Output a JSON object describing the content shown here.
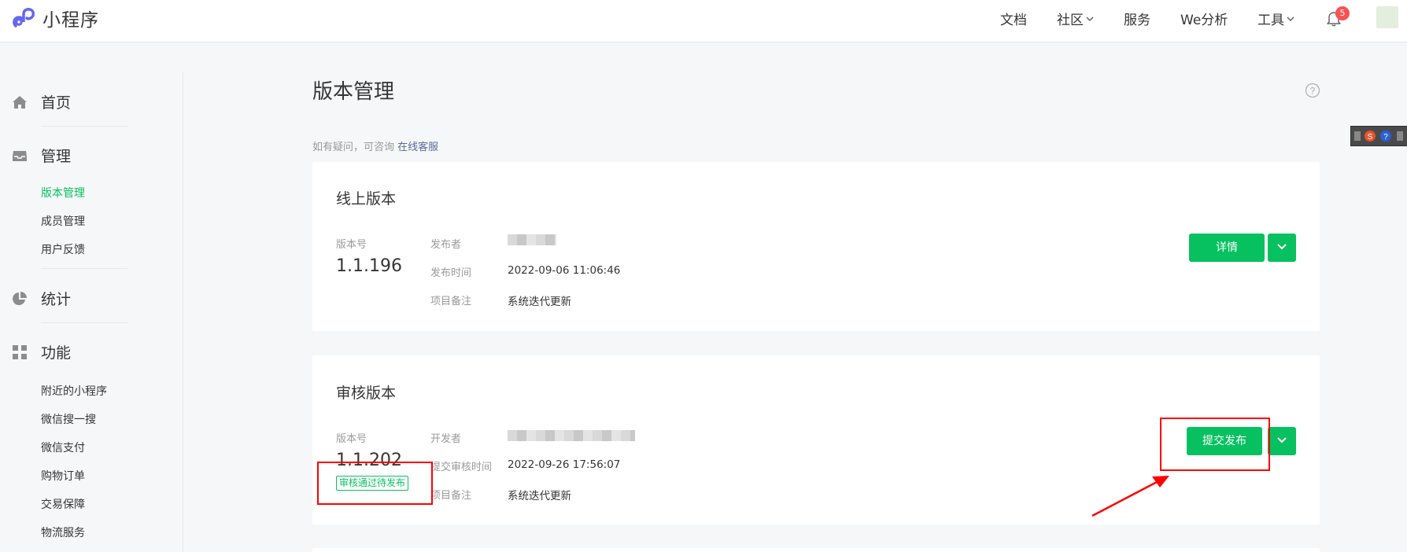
{
  "header": {
    "logo_text": "小程序",
    "nav": [
      {
        "label": "文档"
      },
      {
        "label": "社区"
      },
      {
        "label": "服务"
      },
      {
        "label": "We分析"
      },
      {
        "label": "工具"
      }
    ],
    "notification_count": "5"
  },
  "sidebar": {
    "sections": {
      "home": "首页",
      "manage": "管理",
      "stats": "统计",
      "features": "功能"
    },
    "manage_items": [
      "版本管理",
      "成员管理",
      "用户反馈"
    ],
    "feature_items": [
      "附近的小程序",
      "微信搜一搜",
      "微信支付",
      "购物订单",
      "交易保障",
      "物流服务"
    ]
  },
  "main": {
    "title": "版本管理",
    "hint_text": "如有疑问，可咨询",
    "hint_link": "在线客服",
    "online": {
      "title": "线上版本",
      "version_label": "版本号",
      "version": "1.1.196",
      "publisher_label": "发布者",
      "time_label": "发布时间",
      "time": "2022-09-06 11:06:46",
      "note_label": "项目备注",
      "note": "系统迭代更新",
      "detail_button": "详情"
    },
    "review": {
      "title": "审核版本",
      "version_label": "版本号",
      "version": "1.1.202",
      "status_tag": "审核通过待发布",
      "developer_label": "开发者",
      "time_label": "提交审核时间",
      "time": "2022-09-26 17:56:07",
      "note_label": "项目备注",
      "note": "系统迭代更新",
      "publish_button": "提交发布"
    }
  },
  "colors": {
    "accent": "#07c160",
    "annotation": "#ff0000",
    "link": "#576b95",
    "badge": "#fa5151"
  }
}
